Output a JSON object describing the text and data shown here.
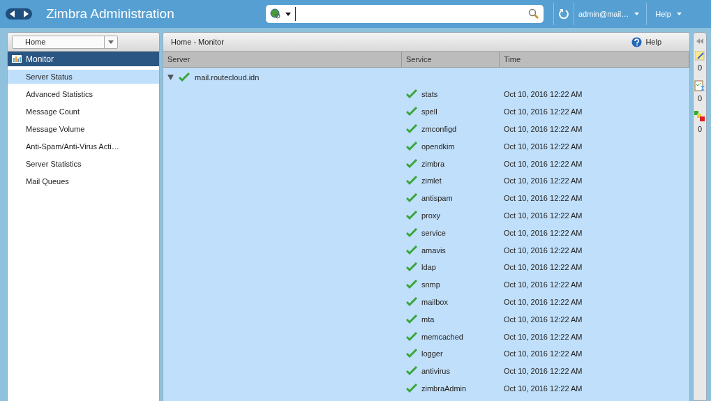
{
  "header": {
    "title": "Zimbra Administration",
    "user": "admin@mail…",
    "help": "Help"
  },
  "nav": {
    "breadcrumb": "Home",
    "section": "Monitor",
    "items": [
      {
        "label": "Server Status",
        "selected": true
      },
      {
        "label": "Advanced Statistics",
        "selected": false
      },
      {
        "label": "Message Count",
        "selected": false
      },
      {
        "label": "Message Volume",
        "selected": false
      },
      {
        "label": "Anti-Spam/Anti-Virus Acti…",
        "selected": false
      },
      {
        "label": "Server Statistics",
        "selected": false
      },
      {
        "label": "Mail Queues",
        "selected": false
      }
    ]
  },
  "main": {
    "title": "Home - Monitor",
    "help": "Help",
    "columns": [
      "Server",
      "Service",
      "Time"
    ],
    "server": {
      "name": "mail.routecloud.idn",
      "running": true,
      "expanded": true,
      "selected": true,
      "services": [
        {
          "name": "stats",
          "running": true,
          "time": "Oct 10, 2016 12:22 AM"
        },
        {
          "name": "spell",
          "running": true,
          "time": "Oct 10, 2016 12:22 AM"
        },
        {
          "name": "zmconfigd",
          "running": true,
          "time": "Oct 10, 2016 12:22 AM"
        },
        {
          "name": "opendkim",
          "running": true,
          "time": "Oct 10, 2016 12:22 AM"
        },
        {
          "name": "zimbra",
          "running": true,
          "time": "Oct 10, 2016 12:22 AM"
        },
        {
          "name": "zimlet",
          "running": true,
          "time": "Oct 10, 2016 12:22 AM"
        },
        {
          "name": "antispam",
          "running": true,
          "time": "Oct 10, 2016 12:22 AM"
        },
        {
          "name": "proxy",
          "running": true,
          "time": "Oct 10, 2016 12:22 AM"
        },
        {
          "name": "service",
          "running": true,
          "time": "Oct 10, 2016 12:22 AM"
        },
        {
          "name": "amavis",
          "running": true,
          "time": "Oct 10, 2016 12:22 AM"
        },
        {
          "name": "ldap",
          "running": true,
          "time": "Oct 10, 2016 12:22 AM"
        },
        {
          "name": "snmp",
          "running": true,
          "time": "Oct 10, 2016 12:22 AM"
        },
        {
          "name": "mailbox",
          "running": true,
          "time": "Oct 10, 2016 12:22 AM"
        },
        {
          "name": "mta",
          "running": true,
          "time": "Oct 10, 2016 12:22 AM"
        },
        {
          "name": "memcached",
          "running": true,
          "time": "Oct 10, 2016 12:22 AM"
        },
        {
          "name": "logger",
          "running": true,
          "time": "Oct 10, 2016 12:22 AM"
        },
        {
          "name": "antivirus",
          "running": true,
          "time": "Oct 10, 2016 12:22 AM"
        },
        {
          "name": "zimbraAdmin",
          "running": true,
          "time": "Oct 10, 2016 12:22 AM"
        }
      ]
    }
  },
  "rail": {
    "counts": [
      "0",
      "0",
      "0"
    ]
  }
}
